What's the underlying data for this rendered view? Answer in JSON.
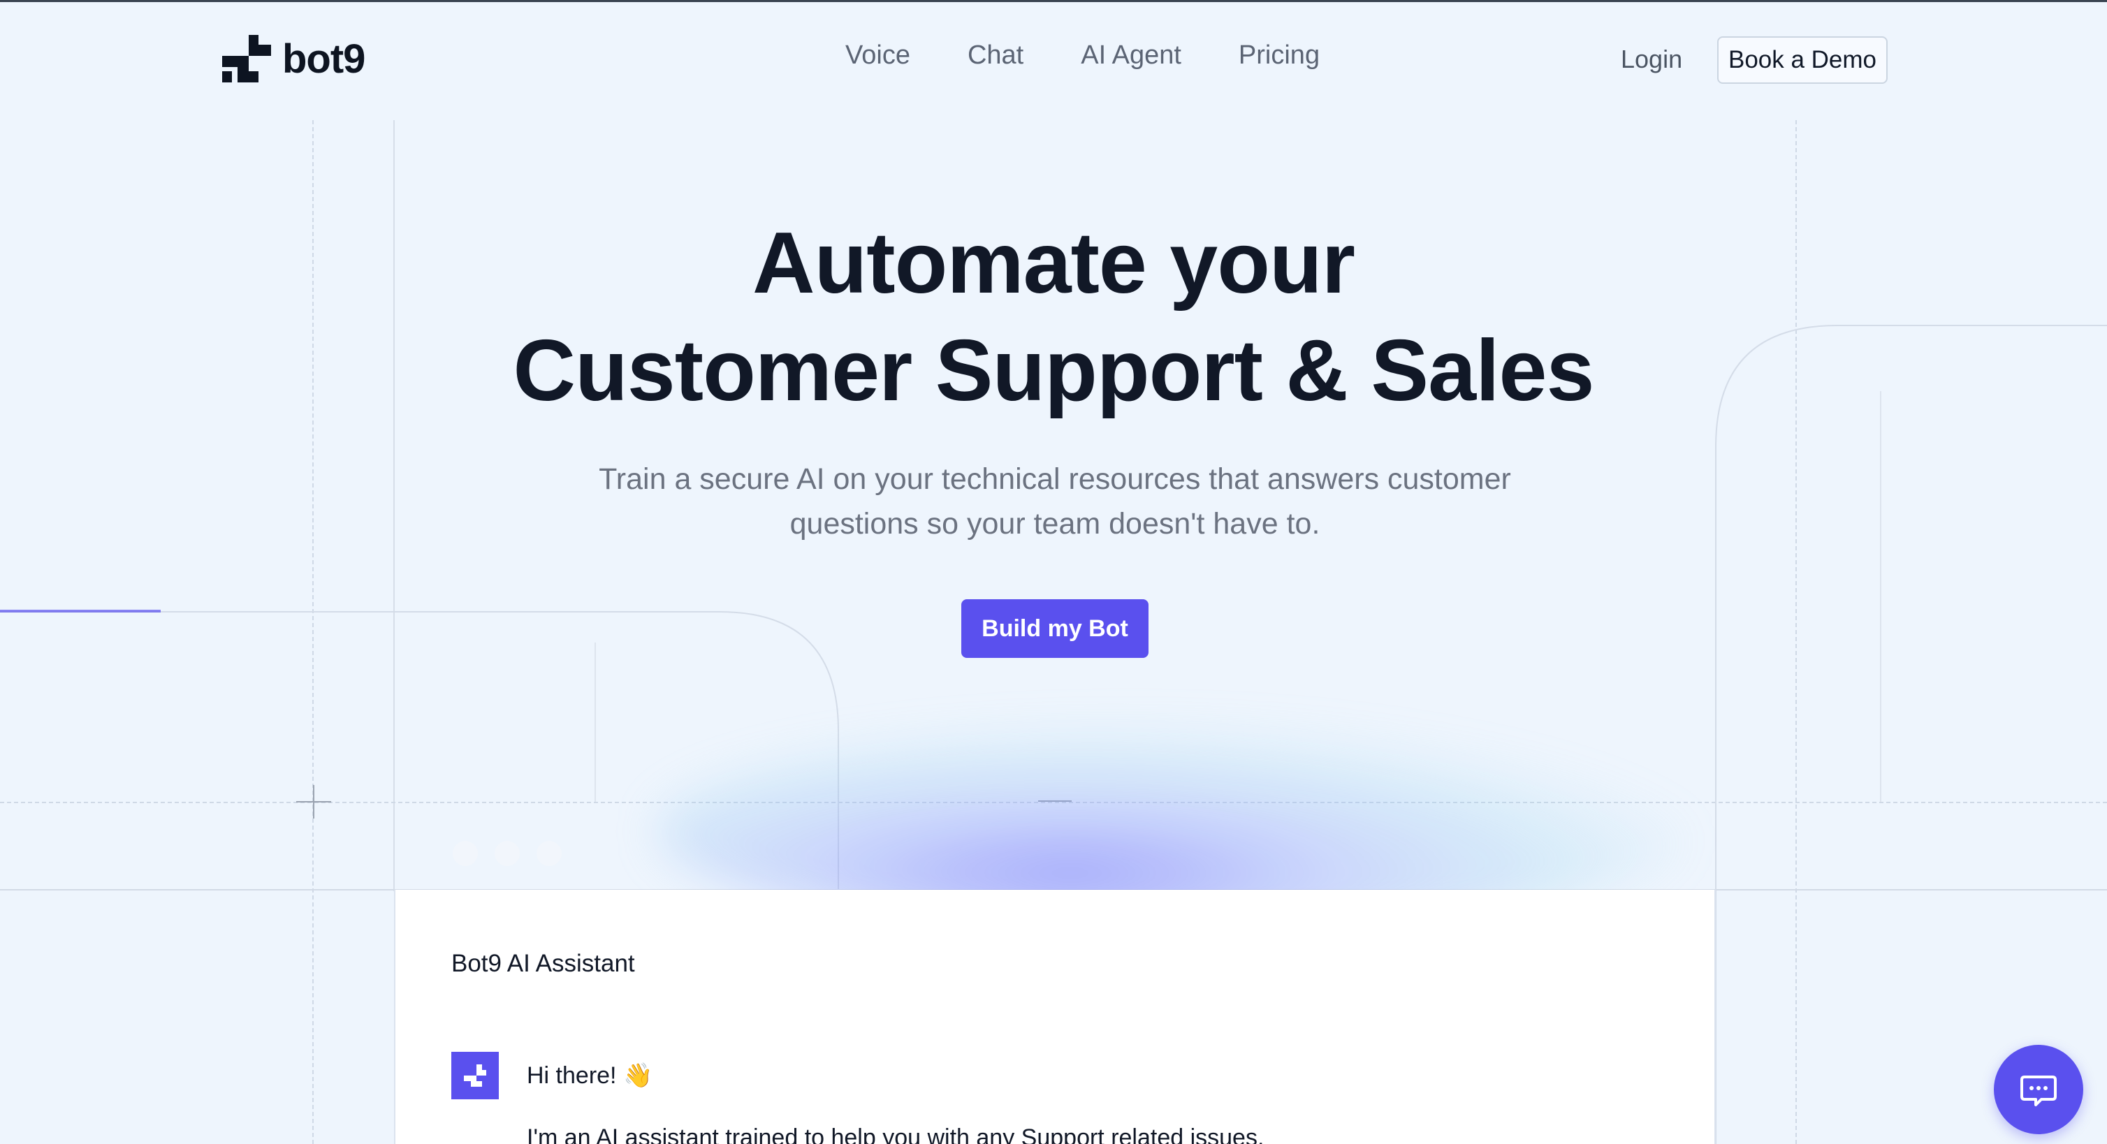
{
  "brand": {
    "name": "bot9",
    "logo_icon": "bot9-logo-icon"
  },
  "nav": {
    "links": [
      "Voice",
      "Chat",
      "AI Agent",
      "Pricing"
    ],
    "login_label": "Login",
    "demo_label": "Book a Demo"
  },
  "hero": {
    "title_line1": "Automate your",
    "title_line2": "Customer Support & Sales",
    "subtitle_line1": "Train a secure AI on your technical resources that answers customer",
    "subtitle_line2": "questions so your team doesn't have to.",
    "cta_label": "Build my Bot"
  },
  "chat_panel": {
    "title": "Bot9 AI Assistant",
    "greeting": "Hi there! 👋",
    "intro": "I'm an AI assistant trained to help you with any Support related issues."
  },
  "widget": {
    "icon": "chat-bubble-icon"
  },
  "colors": {
    "accent": "#5a50ee",
    "background": "#eef5fd",
    "text": "#111827",
    "muted": "#6b7280"
  }
}
